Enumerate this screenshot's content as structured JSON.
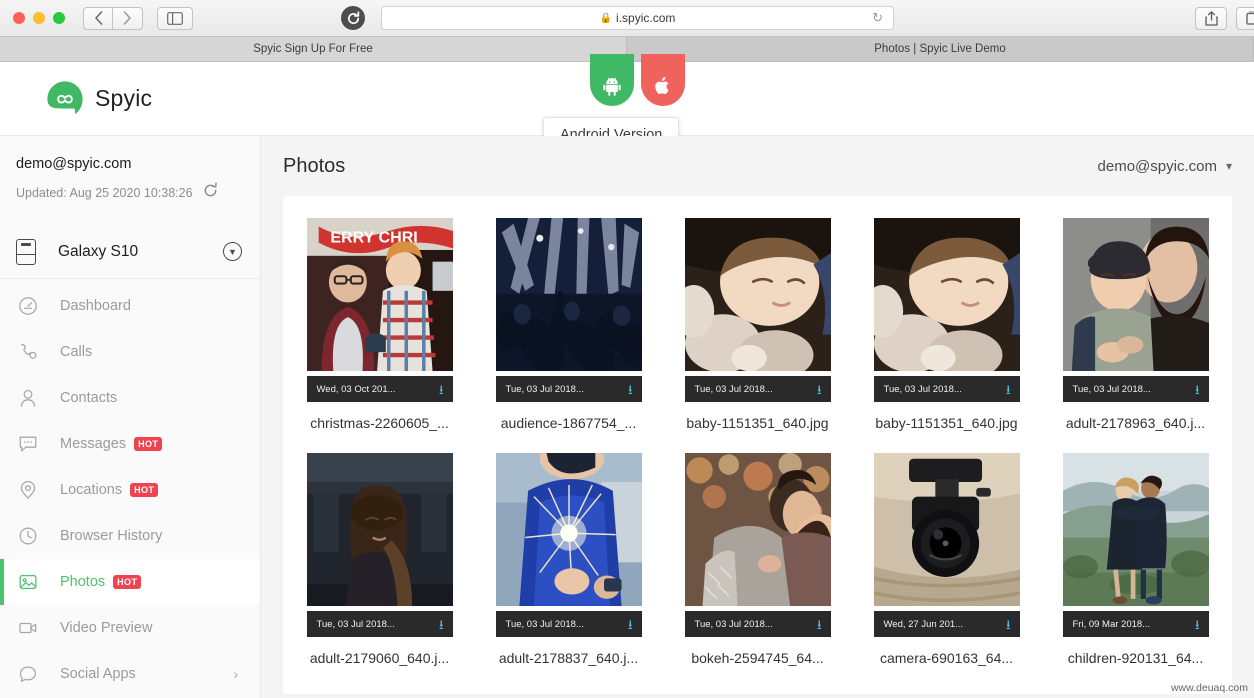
{
  "browser": {
    "url": "i.spyic.com",
    "lock_icon": "lock-icon",
    "reload_icon": "reload-icon",
    "back_icon": "chevron-left-icon",
    "forward_icon": "chevron-right-icon",
    "sidebar_icon": "sidebar-toggle-icon",
    "share_icon": "share-icon",
    "newtab_icon": "new-tab-icon",
    "tabs": [
      {
        "label": "Spyic Sign Up For Free",
        "active": false
      },
      {
        "label": "Photos | Spyic Live Demo",
        "active": true
      }
    ]
  },
  "header": {
    "brand": "Spyic",
    "logo_icon": "spyic-infinity-logo",
    "brand_color": "#3fb963",
    "os_tabs": [
      {
        "name": "android-version-tab",
        "icon": "android-icon",
        "color": "#3fb963"
      },
      {
        "name": "ios-version-tab",
        "icon": "apple-icon",
        "color": "#f0625c"
      }
    ],
    "tooltip": "Android Version"
  },
  "sidebar": {
    "account_email": "demo@spyic.com",
    "updated_label": "Updated: Aug 25 2020 10:38:26",
    "sync_icon": "refresh-icon",
    "device_icon": "phone-icon",
    "device_name": "Galaxy S10",
    "device_caret_icon": "chevron-down-circle-icon",
    "items": [
      {
        "label": "Dashboard",
        "icon": "speedometer-icon",
        "badge": "",
        "active": false,
        "chevron": false
      },
      {
        "label": "Calls",
        "icon": "phone-call-icon",
        "badge": "",
        "active": false,
        "chevron": false
      },
      {
        "label": "Contacts",
        "icon": "person-icon",
        "badge": "",
        "active": false,
        "chevron": false
      },
      {
        "label": "Messages",
        "icon": "message-bubble-icon",
        "badge": "HOT",
        "active": false,
        "chevron": false
      },
      {
        "label": "Locations",
        "icon": "map-pin-icon",
        "badge": "HOT",
        "active": false,
        "chevron": false
      },
      {
        "label": "Browser History",
        "icon": "clock-icon",
        "badge": "",
        "active": false,
        "chevron": false
      },
      {
        "label": "Photos",
        "icon": "photo-icon",
        "badge": "HOT",
        "active": true,
        "chevron": false
      },
      {
        "label": "Video Preview",
        "icon": "video-camera-icon",
        "badge": "",
        "active": false,
        "chevron": false
      },
      {
        "label": "Social Apps",
        "icon": "chat-bubble-icon",
        "badge": "",
        "active": false,
        "chevron": true
      }
    ]
  },
  "main": {
    "title": "Photos",
    "account_email": "demo@spyic.com",
    "account_caret_icon": "chevron-down-icon",
    "download_icon": "download-icon",
    "photos": [
      {
        "date": "Wed, 03 Oct 201...",
        "filename": "christmas-2260605_...",
        "art": "christmas"
      },
      {
        "date": "Tue, 03 Jul 2018...",
        "filename": "audience-1867754_...",
        "art": "audience"
      },
      {
        "date": "Tue, 03 Jul 2018...",
        "filename": "baby-1151351_640.jpg",
        "art": "baby"
      },
      {
        "date": "Tue, 03 Jul 2018...",
        "filename": "baby-1151351_640.jpg",
        "art": "baby"
      },
      {
        "date": "Tue, 03 Jul 2018...",
        "filename": "adult-2178963_640.j...",
        "art": "couple"
      },
      {
        "date": "Tue, 03 Jul 2018...",
        "filename": "adult-2179060_640.j...",
        "art": "woman"
      },
      {
        "date": "Tue, 03 Jul 2018...",
        "filename": "adult-2178837_640.j...",
        "art": "sparkler"
      },
      {
        "date": "Tue, 03 Jul 2018...",
        "filename": "bokeh-2594745_64...",
        "art": "bokeh"
      },
      {
        "date": "Wed, 27 Jun 201...",
        "filename": "camera-690163_64...",
        "art": "camera"
      },
      {
        "date": "Fri, 09 Mar 2018...",
        "filename": "children-920131_64...",
        "art": "children"
      }
    ]
  },
  "watermark": "www.deuaq.com"
}
